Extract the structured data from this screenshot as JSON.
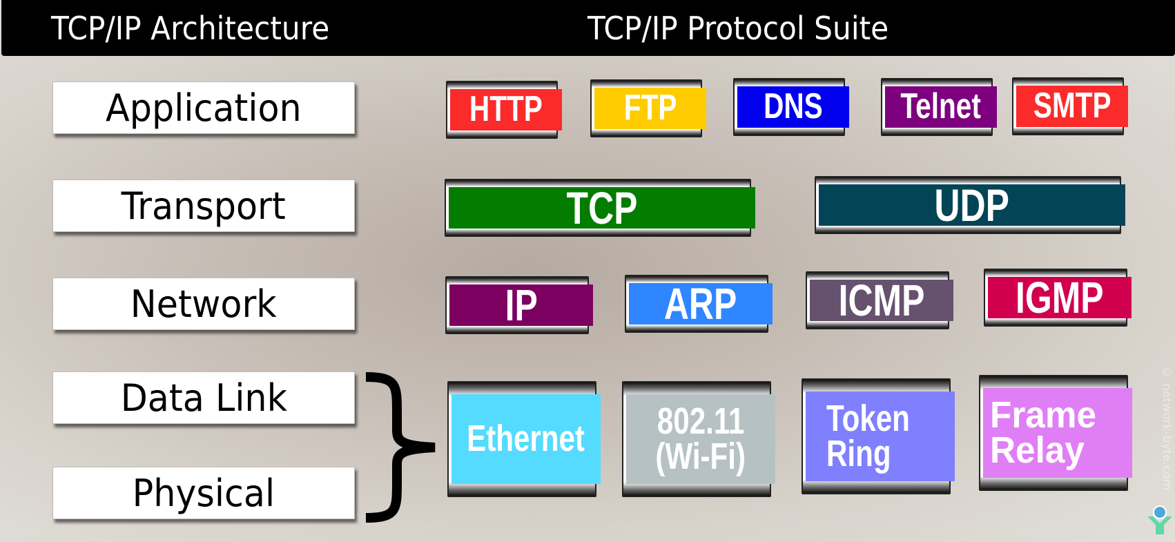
{
  "header": {
    "left_title": "TCP/IP Architecture",
    "right_title": "TCP/IP Protocol Suite"
  },
  "layers": [
    {
      "id": "application",
      "label": "Application"
    },
    {
      "id": "transport",
      "label": "Transport"
    },
    {
      "id": "network",
      "label": "Network"
    },
    {
      "id": "data-link",
      "label": "Data Link"
    },
    {
      "id": "physical",
      "label": "Physical"
    }
  ],
  "protocols": {
    "application": [
      {
        "label": "HTTP",
        "color": "#fb2b2b"
      },
      {
        "label": "FTP",
        "color": "#ffcc00"
      },
      {
        "label": "DNS",
        "color": "#0000ee"
      },
      {
        "label": "Telnet",
        "color": "#7d007f"
      },
      {
        "label": "SMTP",
        "color": "#fb2b2b"
      }
    ],
    "transport": [
      {
        "label": "TCP",
        "color": "#037d00"
      },
      {
        "label": "UDP",
        "color": "#034556"
      }
    ],
    "network": [
      {
        "label": "IP",
        "color": "#7c005f"
      },
      {
        "label": "ARP",
        "color": "#2f86ff"
      },
      {
        "label": "ICMP",
        "color": "#66526e"
      },
      {
        "label": "IGMP",
        "color": "#d0004f"
      }
    ],
    "data_link_physical": [
      {
        "label": "Ethernet",
        "color": "#55dbff"
      },
      {
        "label": "802.11 (Wi-Fi)",
        "line1": "802.11",
        "line2": "(Wi-Fi)",
        "color": "#b6c1c4"
      },
      {
        "label": "Token Ring",
        "line1": "Token",
        "line2": "Ring",
        "color": "#8080ff"
      },
      {
        "label": "Frame Relay",
        "line1": "Frame",
        "line2": "Relay",
        "color": "#e07ff5"
      }
    ]
  },
  "watermark": "© network-byte.com",
  "logo": {
    "name": "network-byte-logo",
    "colors": [
      "#4fa8d8",
      "#5fd8a8"
    ]
  }
}
